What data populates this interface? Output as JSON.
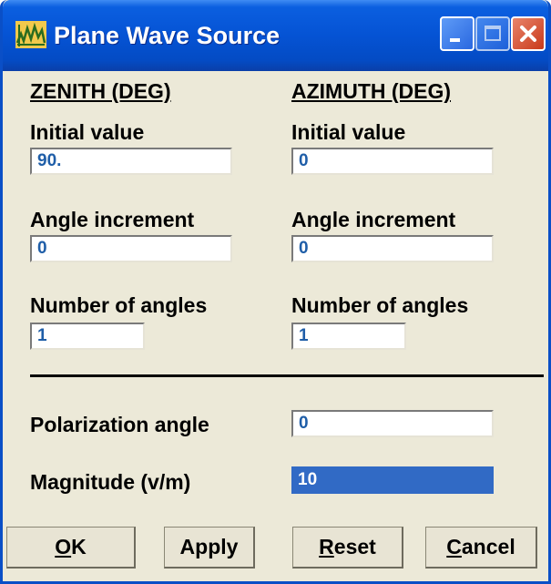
{
  "window": {
    "title": "Plane Wave Source",
    "icons": {
      "app": "plane-wave-app-icon",
      "minimize": "minimize-icon",
      "maximize": "maximize-icon",
      "close": "close-icon"
    },
    "colors": {
      "titlebar": "#0553d4",
      "body": "#ece9d8",
      "field_text": "#1f5ea8",
      "selection": "#316ac5"
    }
  },
  "zenith": {
    "heading": "ZENITH (DEG)",
    "initial_label": "Initial value",
    "initial_value": "90.",
    "increment_label": "Angle increment",
    "increment_value": "0",
    "count_label": "Number of angles",
    "count_value": "1"
  },
  "azimuth": {
    "heading": "AZIMUTH (DEG)",
    "initial_label": "Initial value",
    "initial_value": "0",
    "increment_label": "Angle increment",
    "increment_value": "0",
    "count_label": "Number of angles",
    "count_value": "1"
  },
  "polarization": {
    "label": "Polarization angle",
    "value": "0"
  },
  "magnitude": {
    "label": "Magnitude (v/m)",
    "value": "10"
  },
  "buttons": {
    "ok": {
      "mnemonic": "O",
      "rest": "K"
    },
    "apply": {
      "label": "Apply"
    },
    "reset": {
      "mnemonic": "R",
      "rest": "eset"
    },
    "cancel": {
      "mnemonic": "C",
      "rest": "ancel"
    }
  }
}
